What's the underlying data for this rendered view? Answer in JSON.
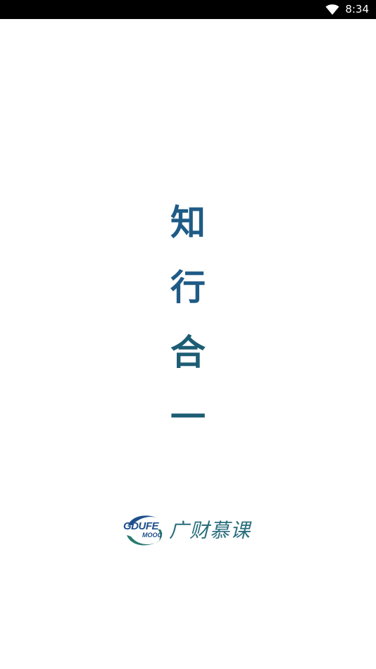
{
  "status_bar": {
    "time": "8:34",
    "wifi_icon": "wifi-icon"
  },
  "splash": {
    "motto_chars": [
      "知",
      "行",
      "合",
      "一"
    ]
  },
  "logo": {
    "mark_text": "GDUFE",
    "mark_subtext": "MOOC",
    "name": "广财慕课"
  },
  "colors": {
    "motto_blue": "#1f5b86",
    "motto_teal": "#1d5d74",
    "logo_blue": "#1f4f8c",
    "logo_green": "#2a7a6e"
  }
}
